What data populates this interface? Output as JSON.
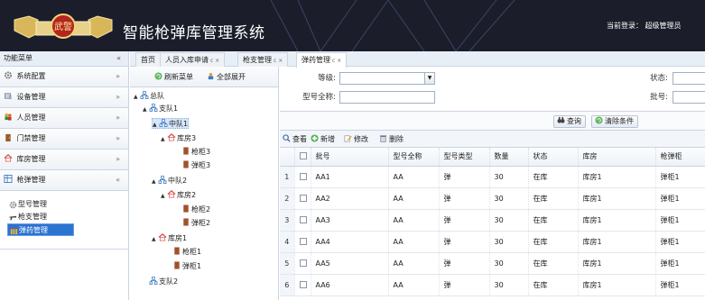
{
  "header": {
    "logo_text": "武警",
    "title": "智能枪弹库管理系统",
    "login_info": "当前登录： 超级管理员"
  },
  "left_menu": {
    "title": "功能菜单",
    "collapse": "«",
    "items": [
      {
        "label": "系统配置",
        "icon": "gear-icon",
        "chevron": "»"
      },
      {
        "label": "设备管理",
        "icon": "device-icon",
        "chevron": "»"
      },
      {
        "label": "人员管理",
        "icon": "users-icon",
        "chevron": "»"
      },
      {
        "label": "门禁管理",
        "icon": "door-icon",
        "chevron": "»"
      },
      {
        "label": "库房管理",
        "icon": "house-icon",
        "chevron": "»"
      },
      {
        "label": "枪弹管理",
        "icon": "grid-icon",
        "chevron": "«"
      }
    ],
    "sub_items": [
      {
        "label": "型号管理",
        "icon": "gear-small-icon"
      },
      {
        "label": "枪支管理",
        "icon": "gun-icon"
      },
      {
        "label": "弹药管理",
        "icon": "ammo-icon"
      }
    ]
  },
  "tabs": [
    {
      "label": "首页",
      "closable": false
    },
    {
      "label": "人员入库申请",
      "closable": true
    },
    {
      "label": "枪支管理",
      "closable": true
    },
    {
      "label": "弹药管理",
      "closable": true
    }
  ],
  "tab_close": "c ×",
  "tree": {
    "refresh_label": "刷新菜单",
    "expand_label": "全部展开",
    "nodes": [
      {
        "label": "总队",
        "type": "org"
      },
      {
        "label": "支队1",
        "type": "org"
      },
      {
        "label": "中队1",
        "type": "org"
      },
      {
        "label": "库房3",
        "type": "house"
      },
      {
        "label": "枪柜3",
        "type": "cabinet"
      },
      {
        "label": "弹柜3",
        "type": "cabinet"
      },
      {
        "label": "中队2",
        "type": "org"
      },
      {
        "label": "库房2",
        "type": "house"
      },
      {
        "label": "枪柜2",
        "type": "cabinet"
      },
      {
        "label": "弹柜2",
        "type": "cabinet"
      },
      {
        "label": "库房1",
        "type": "house"
      },
      {
        "label": "枪柜1",
        "type": "cabinet"
      },
      {
        "label": "弹柜1",
        "type": "cabinet"
      },
      {
        "label": "支队2",
        "type": "org"
      }
    ]
  },
  "filters": {
    "level_label": "等级:",
    "level_value": "",
    "model_label": "型号全称:",
    "model_value": "",
    "status_label": "状态:",
    "batch_label": "批号:"
  },
  "search": {
    "query_label": "查询",
    "clear_label": "清除条件"
  },
  "toolbar": {
    "view_label": "查看",
    "add_label": "新增",
    "edit_label": "修改",
    "delete_label": "删除"
  },
  "grid": {
    "columns": [
      "批号",
      "型号全称",
      "型号类型",
      "数量",
      "状态",
      "库房",
      "枪弹柜"
    ],
    "rows": [
      {
        "no": "1",
        "batch": "AA1",
        "model": "AA",
        "type": "弹",
        "qty": "30",
        "status": "在库",
        "house": "库房1",
        "cabinet": "弹柜1"
      },
      {
        "no": "2",
        "batch": "AA2",
        "model": "AA",
        "type": "弹",
        "qty": "30",
        "status": "在库",
        "house": "库房1",
        "cabinet": "弹柜1"
      },
      {
        "no": "3",
        "batch": "AA3",
        "model": "AA",
        "type": "弹",
        "qty": "30",
        "status": "在库",
        "house": "库房1",
        "cabinet": "弹柜1"
      },
      {
        "no": "4",
        "batch": "AA4",
        "model": "AA",
        "type": "弹",
        "qty": "30",
        "status": "在库",
        "house": "库房1",
        "cabinet": "弹柜1"
      },
      {
        "no": "5",
        "batch": "AA5",
        "model": "AA",
        "type": "弹",
        "qty": "30",
        "status": "在库",
        "house": "库房1",
        "cabinet": "弹柜1"
      },
      {
        "no": "6",
        "batch": "AA6",
        "model": "AA",
        "type": "弹",
        "qty": "30",
        "status": "在库",
        "house": "库房1",
        "cabinet": "弹柜1"
      }
    ]
  },
  "colors": {
    "header_bg": "#1b1d2a",
    "active_menu": "#2b73d1",
    "panel_border": "#c9d4e2"
  }
}
